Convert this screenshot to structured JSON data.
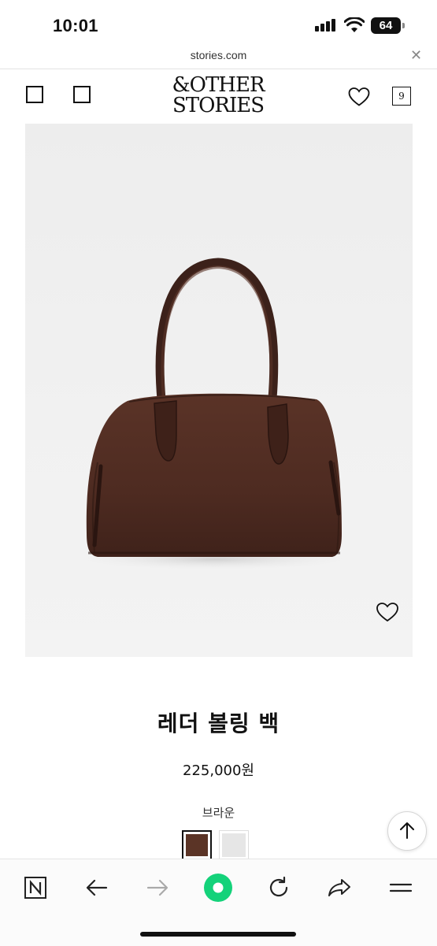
{
  "status_bar": {
    "time": "10:01",
    "battery": "64"
  },
  "url_bar": {
    "domain": "stories.com",
    "close_icon": "close-icon"
  },
  "header": {
    "logo_line1": "&OTHER",
    "logo_line2": "STORIES",
    "bag_count": "9",
    "icons": [
      "menu-square-icon",
      "search-square-icon",
      "heart-icon",
      "bag-icon"
    ]
  },
  "product": {
    "title": "레더 볼링 백",
    "price": "225,000원",
    "color_name": "브라운",
    "swatches": [
      {
        "color": "#5b3426",
        "selected": true
      },
      {
        "color": "#e6e6e6",
        "selected": false
      }
    ]
  },
  "browser_toolbar": {
    "icons": [
      "naver-n-icon",
      "back-arrow-icon",
      "forward-arrow-icon",
      "green-dot-icon",
      "reload-icon",
      "share-icon",
      "menu-icon"
    ],
    "accent": "#14d27a"
  }
}
